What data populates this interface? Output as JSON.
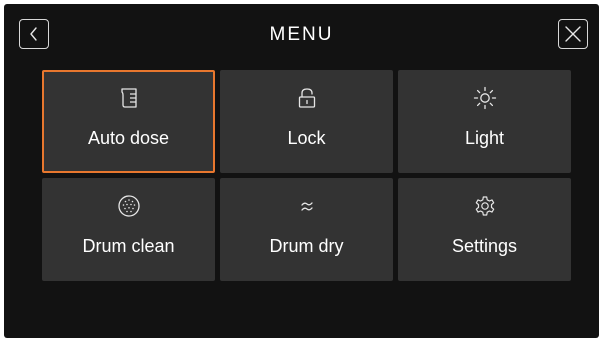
{
  "header": {
    "title": "MENU"
  },
  "tiles": [
    {
      "label": "Auto dose",
      "icon": "detergent-container-icon",
      "selected": true
    },
    {
      "label": "Lock",
      "icon": "lock-icon",
      "selected": false
    },
    {
      "label": "Light",
      "icon": "sun-icon",
      "selected": false
    },
    {
      "label": "Drum clean",
      "icon": "drum-clean-icon",
      "selected": false
    },
    {
      "label": "Drum dry",
      "icon": "drum-dry-icon",
      "selected": false
    },
    {
      "label": "Settings",
      "icon": "gear-icon",
      "selected": false
    }
  ],
  "colors": {
    "background": "#121212",
    "tile": "#333333",
    "selected_border": "#e8772e",
    "text": "#ffffff"
  }
}
